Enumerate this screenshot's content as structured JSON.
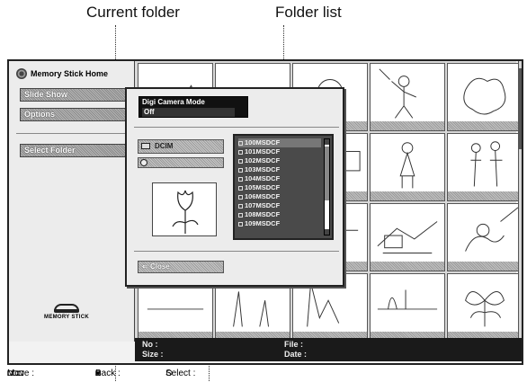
{
  "callouts": {
    "current_folder": "Current folder",
    "folder_list": "Folder list"
  },
  "sidebar": {
    "home_title": "Memory Stick Home",
    "slide_show": "Slide Show",
    "options": "Options",
    "select_folder": "Select Folder",
    "logo_text": "MEMORY STICK"
  },
  "dialog": {
    "mode_label": "Digi Camera Mode",
    "mode_value": "Off",
    "current_folder": "DCIM",
    "folders": [
      "100MSDCF",
      "101MSDCF",
      "102MSDCF",
      "103MSDCF",
      "104MSDCF",
      "105MSDCF",
      "106MSDCF",
      "107MSDCF",
      "108MSDCF",
      "109MSDCF"
    ],
    "close_label": "Close"
  },
  "info": {
    "no_label": "No :",
    "size_label": "Size :",
    "file_label": "File :",
    "date_label": "Date :"
  },
  "status": {
    "move": "Move :",
    "back": "Back :",
    "select": "Select :"
  }
}
